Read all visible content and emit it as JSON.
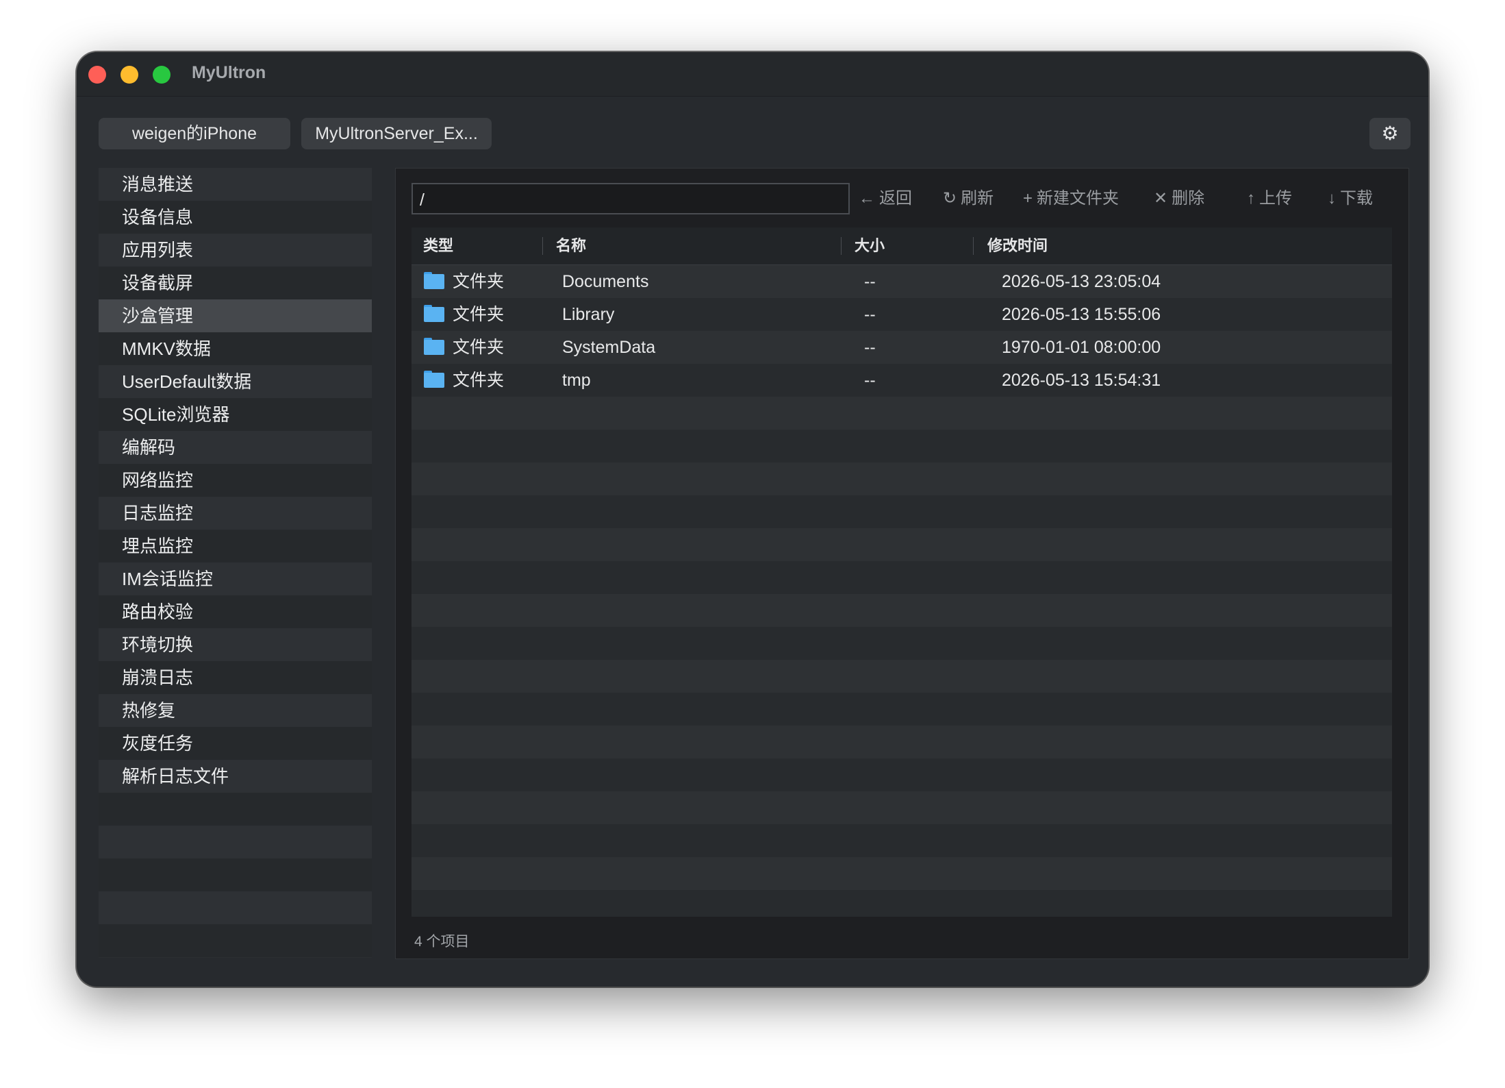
{
  "window": {
    "title": "MyUltron"
  },
  "tabs": [
    "weigen的iPhone",
    "MyUltronServer_Ex..."
  ],
  "settings": {
    "icon": "gear-icon",
    "glyph": "⚙"
  },
  "sidebar": {
    "items": [
      {
        "label": "消息推送"
      },
      {
        "label": "设备信息"
      },
      {
        "label": "应用列表"
      },
      {
        "label": "设备截屏"
      },
      {
        "label": "沙盒管理"
      },
      {
        "label": "MMKV数据"
      },
      {
        "label": "UserDefault数据"
      },
      {
        "label": "SQLite浏览器"
      },
      {
        "label": "编解码"
      },
      {
        "label": "网络监控"
      },
      {
        "label": "日志监控"
      },
      {
        "label": "埋点监控"
      },
      {
        "label": "IM会话监控"
      },
      {
        "label": "路由校验"
      },
      {
        "label": "环境切换"
      },
      {
        "label": "崩溃日志"
      },
      {
        "label": "热修复"
      },
      {
        "label": "灰度任务"
      },
      {
        "label": "解析日志文件"
      }
    ],
    "active_index": 4
  },
  "path": {
    "value": "/"
  },
  "toolbar": {
    "back": {
      "icon": "←",
      "label": "返回"
    },
    "refresh": {
      "icon": "↻",
      "label": "刷新"
    },
    "new_folder": {
      "icon": "+",
      "label": "新建文件夹"
    },
    "delete": {
      "icon": "✕",
      "label": "删除"
    },
    "upload": {
      "icon": "↑",
      "label": "上传"
    },
    "download": {
      "icon": "↓",
      "label": "下载"
    }
  },
  "table": {
    "columns": [
      "类型",
      "名称",
      "大小",
      "修改时间"
    ],
    "rows": [
      {
        "type": "文件夹",
        "name": "Documents",
        "size": "--",
        "modified": "2026-05-13 23:05:04"
      },
      {
        "type": "文件夹",
        "name": "Library",
        "size": "--",
        "modified": "2026-05-13 15:55:06"
      },
      {
        "type": "文件夹",
        "name": "SystemData",
        "size": "--",
        "modified": "1970-01-01 08:00:00"
      },
      {
        "type": "文件夹",
        "name": "tmp",
        "size": "--",
        "modified": "2026-05-13 15:54:31"
      }
    ]
  },
  "status": {
    "text": "4 个项目"
  },
  "colors": {
    "window_bg": "#272a2e",
    "folder": "#5ab3f2"
  }
}
